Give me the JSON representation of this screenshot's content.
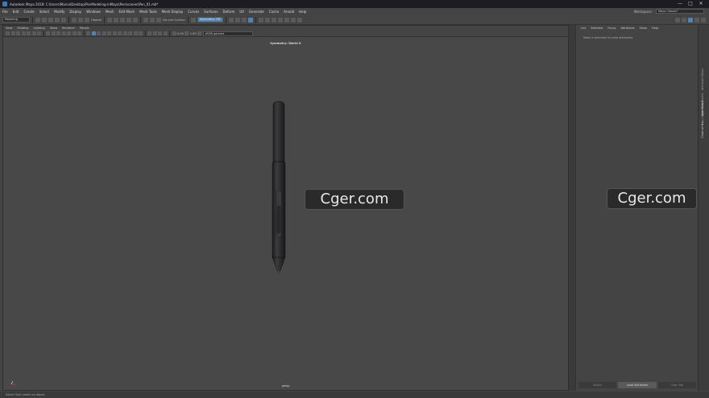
{
  "window": {
    "title": "Autodesk Maya 2018: C:\\Users\\Marco\\Desktop\\PenModeling-inMaya\\Pen\\scenes\\Pen_01.mb*",
    "controls": [
      "—",
      "□",
      "✕"
    ]
  },
  "menubar": {
    "items": [
      "File",
      "Edit",
      "Create",
      "Select",
      "Modify",
      "Display",
      "Windows",
      "Mesh",
      "Edit Mesh",
      "Mesh Tools",
      "Mesh Display",
      "Curves",
      "Surfaces",
      "Deform",
      "UV",
      "Generate",
      "Cache",
      "Arnold",
      "Help"
    ],
    "workspace_label": "Workspace:",
    "workspace_value": "Maya Classic*"
  },
  "statusline": {
    "menuset": "Modeling",
    "selection_mode": "Objects",
    "live_surface": "No Live Surface",
    "symmetry": "Symmetry: Off"
  },
  "panel": {
    "menu": [
      "View",
      "Shading",
      "Lighting",
      "Show",
      "Renderer",
      "Panels"
    ],
    "field_a": "0.00",
    "field_b": "1.00",
    "colorspace": "sRGB gamma",
    "title": "Symmetry: World X",
    "camera": "persp"
  },
  "attribute_editor": {
    "menu": [
      "List",
      "Selected",
      "Focus",
      "Attributes",
      "Show",
      "Help"
    ],
    "message": "Make a selection to view attributes",
    "buttons": [
      "Select",
      "Load Attributes",
      "Copy Tab"
    ]
  },
  "side_tabs": [
    "Attribute Editor",
    "Modeling Toolkit",
    "Channel Box / Layer Editor"
  ],
  "helpline": "Select Tool: select an object",
  "watermarks": [
    "Cger.com",
    "Cger.com"
  ],
  "colors": {
    "accent": "#5283b5",
    "viewport": "#484848",
    "pen_body": "#2c2c2e"
  }
}
